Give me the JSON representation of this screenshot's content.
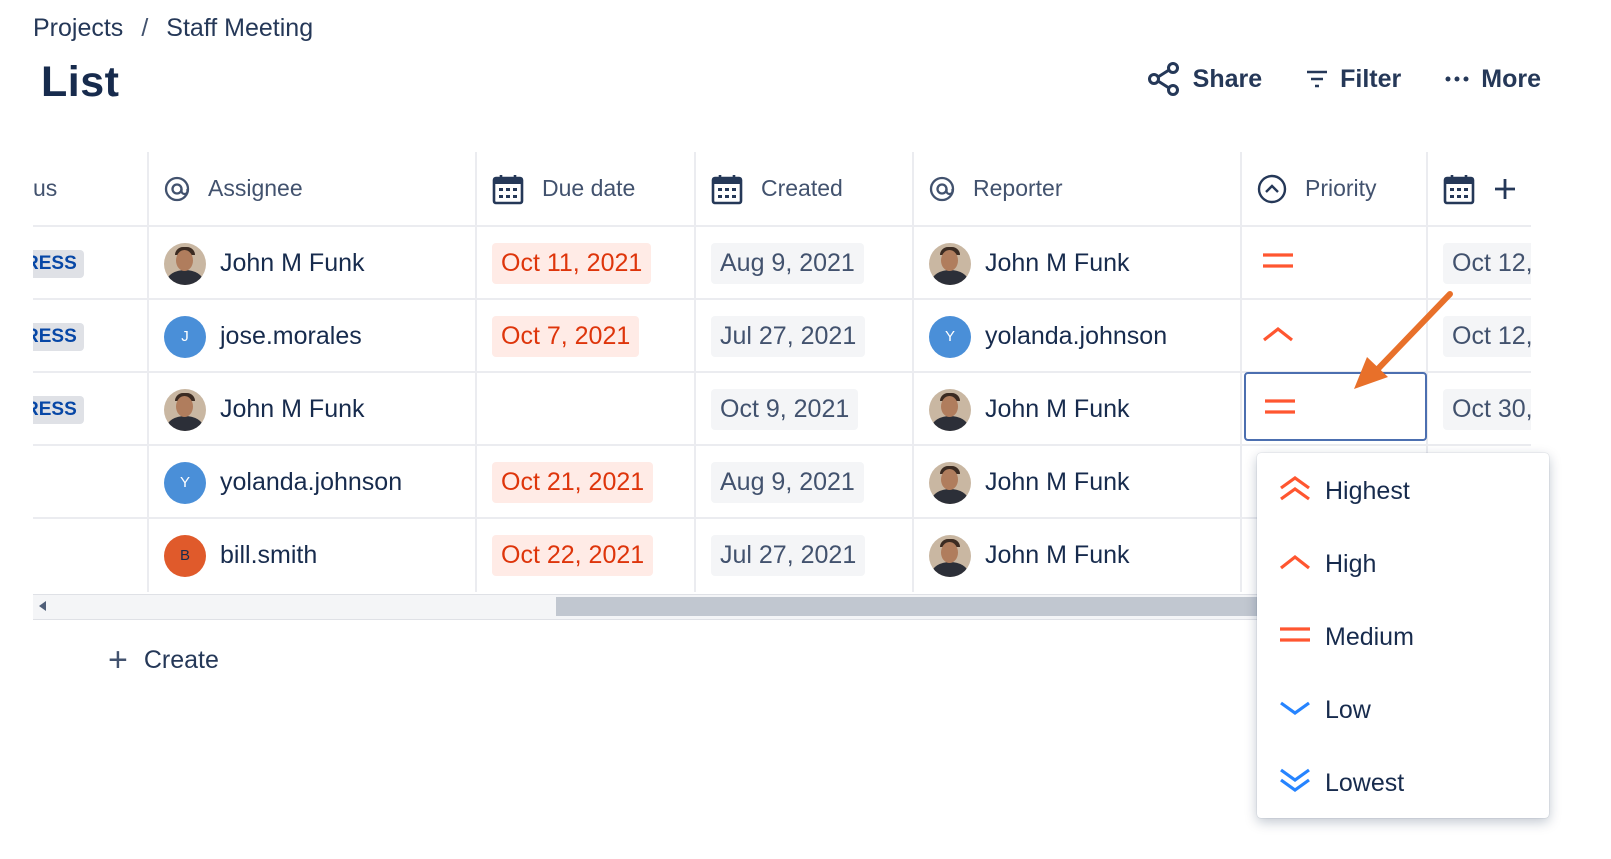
{
  "breadcrumb": {
    "root": "Projects",
    "separator": "/",
    "current": "Staff Meeting"
  },
  "page_title": "List",
  "toolbar": {
    "share": "Share",
    "filter": "Filter",
    "more": "More"
  },
  "columns": {
    "status": "us",
    "assignee": "Assignee",
    "due_date": "Due date",
    "created": "Created",
    "reporter": "Reporter",
    "priority": "Priority"
  },
  "rows": [
    {
      "status": "RESS",
      "assignee": "John M Funk",
      "assignee_avatar": "photo",
      "due": "Oct 11, 2021",
      "due_overdue": true,
      "created": "Aug 9, 2021",
      "reporter": "John M Funk",
      "reporter_avatar": "photo",
      "priority": "medium",
      "extra_date": "Oct 12,"
    },
    {
      "status": "RESS",
      "assignee": "jose.morales",
      "assignee_avatar": "J",
      "due": "Oct 7, 2021",
      "due_overdue": true,
      "created": "Jul 27, 2021",
      "reporter": "yolanda.johnson",
      "reporter_avatar": "Y",
      "priority": "high",
      "extra_date": "Oct 12,"
    },
    {
      "status": "RESS",
      "assignee": "John M Funk",
      "assignee_avatar": "photo",
      "due": "",
      "due_overdue": false,
      "created": "Oct 9, 2021",
      "reporter": "John M Funk",
      "reporter_avatar": "photo",
      "priority": "medium",
      "extra_date": "Oct 30,"
    },
    {
      "status": "",
      "assignee": "yolanda.johnson",
      "assignee_avatar": "Y",
      "due": "Oct 21, 2021",
      "due_overdue": true,
      "created": "Aug 9, 2021",
      "reporter": "John M Funk",
      "reporter_avatar": "photo",
      "priority": "",
      "extra_date": ""
    },
    {
      "status": "",
      "assignee": "bill.smith",
      "assignee_avatar": "B",
      "due": "Oct 22, 2021",
      "due_overdue": true,
      "created": "Jul 27, 2021",
      "reporter": "John M Funk",
      "reporter_avatar": "photo",
      "priority": "",
      "extra_date": ""
    }
  ],
  "create_label": "Create",
  "priority_options": [
    {
      "label": "Highest",
      "icon": "priority-highest-icon"
    },
    {
      "label": "High",
      "icon": "priority-high-icon"
    },
    {
      "label": "Medium",
      "icon": "priority-medium-icon"
    },
    {
      "label": "Low",
      "icon": "priority-low-icon"
    },
    {
      "label": "Lowest",
      "icon": "priority-lowest-icon"
    }
  ],
  "colors": {
    "accent": "#0052cc",
    "overdue": "#de350b",
    "priority_up": "#ff5630",
    "priority_down": "#2684ff",
    "annotation_arrow": "#e8702a"
  }
}
